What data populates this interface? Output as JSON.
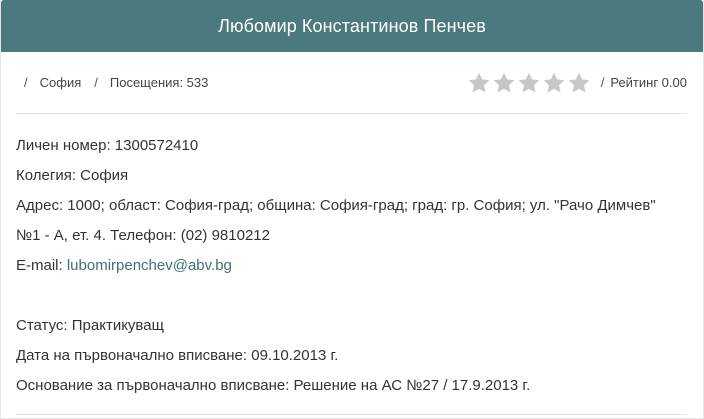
{
  "header": {
    "title": "Любомир Константинов Пенчев"
  },
  "meta": {
    "separator": "/",
    "city": "София",
    "visits": "Посещения: 533",
    "rating_value": 0,
    "rating_max": 5,
    "rating_label": "Рейтинг 0.00"
  },
  "details": {
    "personal_number": "Личен номер: 1300572410",
    "collegium": "Колегия: София",
    "address_line1": "Адрес: 1000; област: София-град; община: София-град; град: гр. София; ул. \"Рачо Димчев\"",
    "address_line2": "№1 - А, ет. 4. Телефон: (02) 9810212",
    "email_label": "E-mail: ",
    "email_value": "lubomirpenchev@abv.bg",
    "status": "Статус: Практикуващ",
    "registration_date": "Дата на първоначално вписване: 09.10.2013 г.",
    "registration_basis": "Основание за първоначално вписване: Решение на АС №27 / 17.9.2013 г."
  },
  "colors": {
    "header_bg": "#4a7a7e",
    "star_empty": "#c7c7c7",
    "link": "#3d7173"
  },
  "icons": {
    "star": "star-icon"
  }
}
